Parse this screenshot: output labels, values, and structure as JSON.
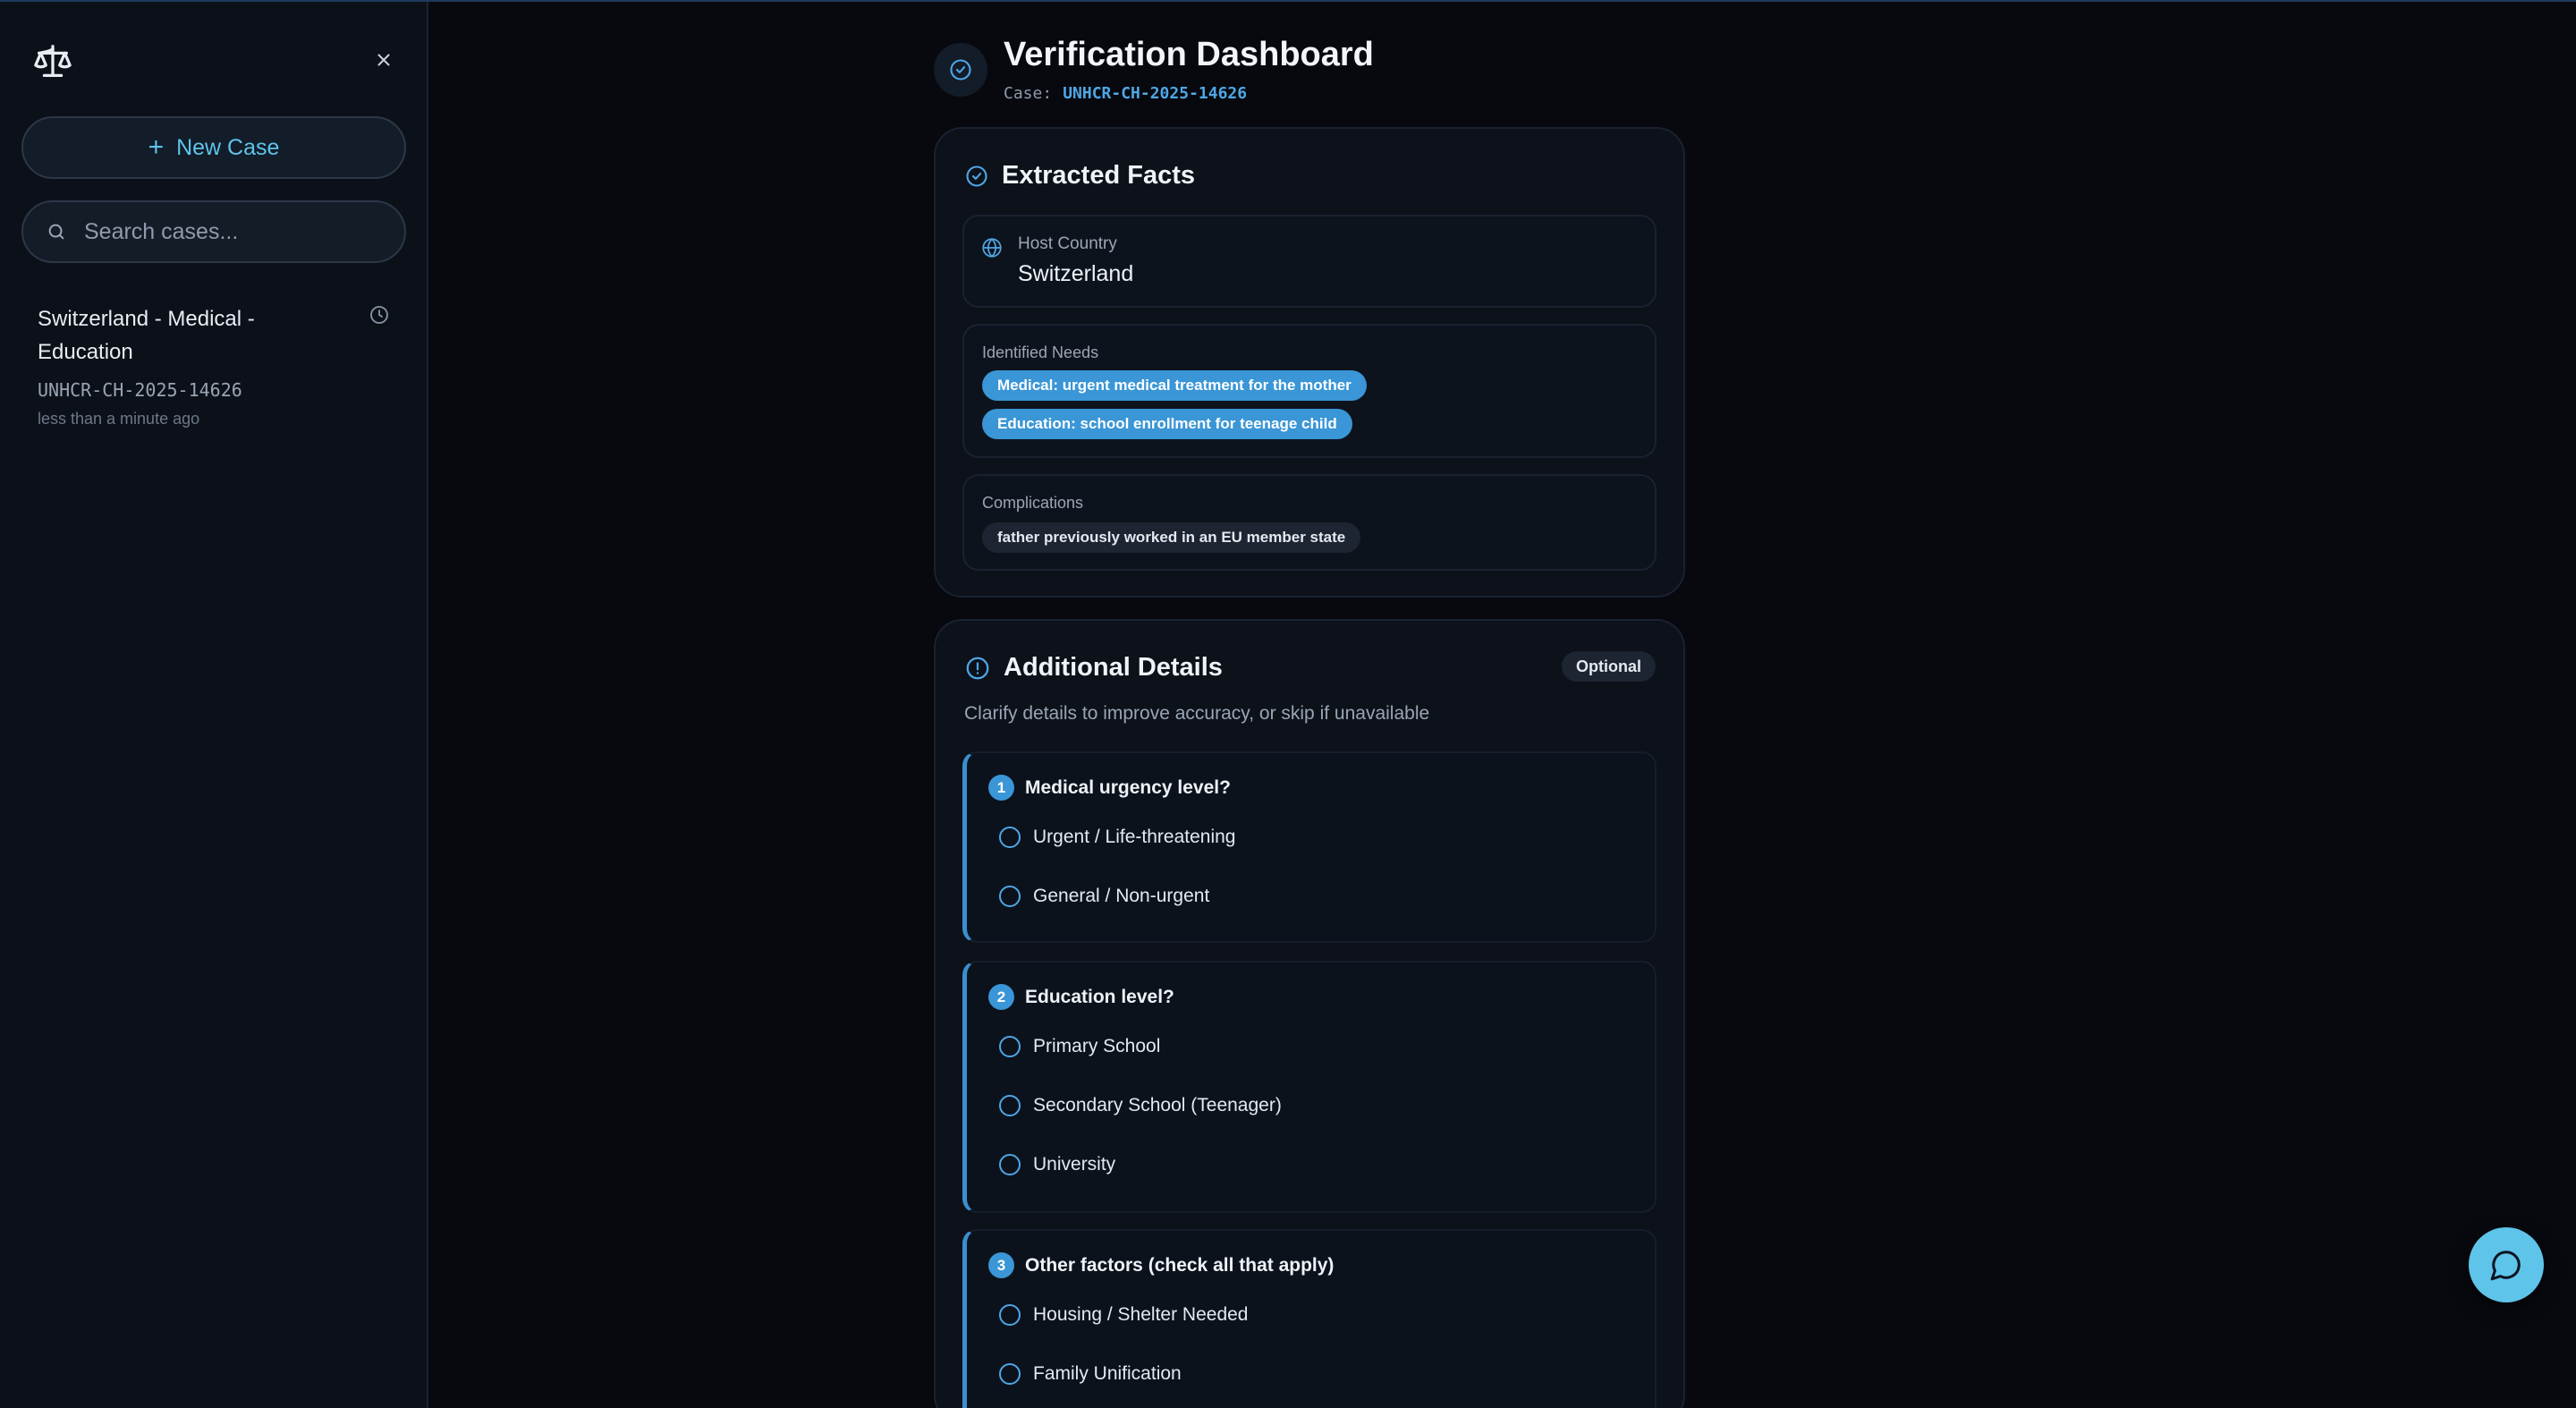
{
  "sidebar": {
    "new_case_label": "New Case",
    "search_placeholder": "Search cases...",
    "cases": [
      {
        "title": "Switzerland - Medical - Education",
        "case_id": "UNHCR-CH-2025-14626",
        "time": "less than a minute ago"
      }
    ]
  },
  "header": {
    "title": "Verification Dashboard",
    "case_label": "Case:",
    "case_id": "UNHCR-CH-2025-14626"
  },
  "facts": {
    "title": "Extracted Facts",
    "host_country_label": "Host Country",
    "host_country": "Switzerland",
    "needs_label": "Identified Needs",
    "needs": [
      "Medical: urgent medical treatment for the mother",
      "Education: school enrollment for teenage child"
    ],
    "complications_label": "Complications",
    "complications": [
      "father previously worked in an EU member state"
    ]
  },
  "details": {
    "title": "Additional Details",
    "badge": "Optional",
    "description": "Clarify details to improve accuracy, or skip if unavailable",
    "questions": [
      {
        "number": "1",
        "text": "Medical urgency level?",
        "options": [
          "Urgent / Life-threatening",
          "General / Non-urgent"
        ]
      },
      {
        "number": "2",
        "text": "Education level?",
        "options": [
          "Primary School",
          "Secondary School (Teenager)",
          "University"
        ]
      },
      {
        "number": "3",
        "text": "Other factors (check all that apply)",
        "options": [
          "Housing / Shelter Needed",
          "Family Unification"
        ]
      }
    ]
  },
  "icons": {
    "logo": "scale-icon",
    "close": "close-icon",
    "search": "search-icon",
    "history": "clock-icon",
    "verified": "check-circle-icon",
    "globe": "globe-icon",
    "info": "alert-circle-icon",
    "chat": "chat-bubble-icon"
  },
  "colors": {
    "accent": "#5ec4ea",
    "primary_blue": "#3a96d6",
    "background": "#07090e",
    "sidebar": "#0c1119"
  }
}
